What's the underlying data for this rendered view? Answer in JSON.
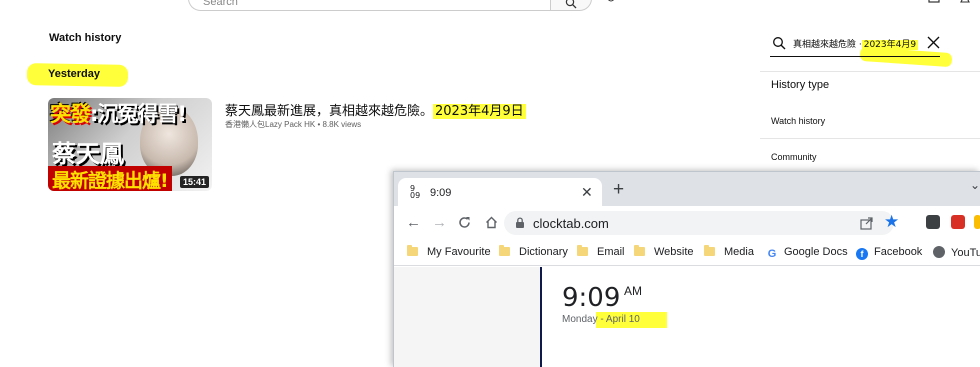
{
  "search": {
    "placeholder": "Search"
  },
  "page": {
    "title": "Watch history",
    "section": "Yesterday"
  },
  "video": {
    "title_prefix": "蔡天鳳最新進展，真相越來越危險。",
    "title_date": "2023年4月9日",
    "channel": "香港懶人包Lazy Pack HK",
    "views": "8.8K views",
    "duration": "15:41",
    "thumb_line1a": "突發",
    "thumb_line1b": ":沉冤得雪!",
    "thumb_line2": "蔡天鳳",
    "thumb_line3": "最新證據出爐!"
  },
  "history_panel": {
    "query_prefix": "真相越來越危險 ·",
    "query_date": "2023年4月9",
    "history_type_label": "History type",
    "options": [
      "Watch history",
      "Community"
    ]
  },
  "browser": {
    "tab_favicon_top": "9",
    "tab_favicon_bottom": "09",
    "tab_title": "9:09",
    "url": "clocktab.com",
    "bookmarks": [
      "My Favourite",
      "Dictionary",
      "Email",
      "Website",
      "Media",
      "Google Docs",
      "Facebook",
      "YouTube"
    ],
    "clock": {
      "time": "9:09",
      "ampm": "AM",
      "weekday": "Monday",
      "date": "- April 10"
    }
  },
  "colors": {
    "highlight": "#ffff3a",
    "accent_blue": "#1a73e8",
    "youtube_red": "#ff0000"
  }
}
